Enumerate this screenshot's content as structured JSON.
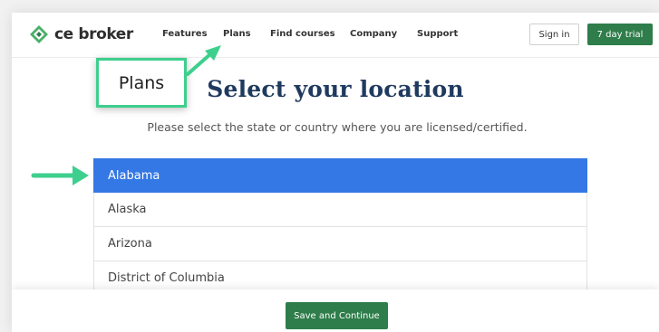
{
  "header": {
    "logo_text": "ce broker",
    "nav": [
      "Features",
      "Plans",
      "Find courses",
      "Company",
      "Support"
    ],
    "signin_label": "Sign in",
    "trial_label": "7 day trial"
  },
  "main": {
    "title": "Select your location",
    "subtitle": "Please select the state or country where you are licensed/certified.",
    "states": [
      "Alabama",
      "Alaska",
      "Arizona",
      "District of Columbia"
    ],
    "selected_state": "Alabama"
  },
  "footer": {
    "save_label": "Save and Continue"
  },
  "annotation": {
    "callout_label": "Plans"
  },
  "colors": {
    "brand_green": "#2e7d4a",
    "selected_blue": "#3478e5",
    "annotation_green": "#3ecf8e",
    "title_navy": "#1f3a5f"
  },
  "icons": {
    "logo": "cebroker-logo-icon",
    "arrows": "arrow-icon"
  }
}
